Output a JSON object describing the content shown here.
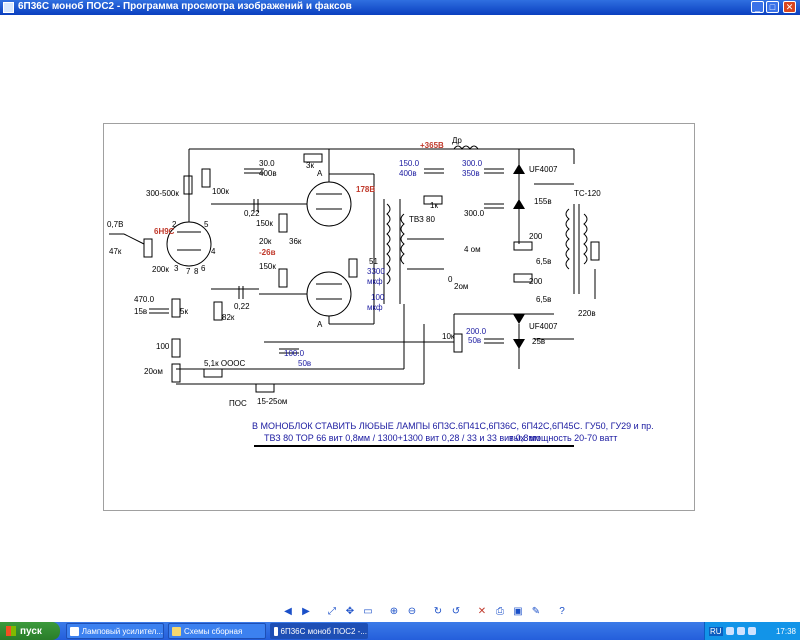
{
  "window": {
    "title": "6П36С моноб ПОС2 - Программа просмотра изображений и факсов"
  },
  "schematic": {
    "tubes": {
      "input": "6Н9С",
      "out_a": "А",
      "out_b": "А"
    },
    "transformer": {
      "output": "ТВЗ 80",
      "power": "ТС-120",
      "choke": "Др"
    },
    "components": {
      "r_300_500k": "300-500к",
      "r_100k": "100к",
      "c_30": "30.0",
      "c_30_v": "400в",
      "r_3k": "3к",
      "c_150": "150.0",
      "c_150_v": "400в",
      "c_300a": "300.0",
      "c_300a_v": "350в",
      "c_300b": "300.0",
      "r_1k": "1к",
      "v_365": "+365В",
      "v_178": "178В",
      "uf_top": "UF4007",
      "v_155": "155в",
      "c_022a": "0,22",
      "r_150k_a": "150к",
      "r_20k": "20к",
      "r_36k": "36к",
      "v_26": "-26в",
      "r_150k_b": "150к",
      "r_51": "51",
      "c_3300": "3300",
      "c_3300_u": "мкф",
      "c_100": "100",
      "c_100_u": "мкф",
      "r_200a": "200",
      "v_65a": "6,5в",
      "r_200b": "200",
      "v_65b": "6,5в",
      "v_220": "220в",
      "out_4": "4 ом",
      "out_0": "0",
      "out_2": "2ом",
      "in_v": "0,7В",
      "r_47k": "47к",
      "r_200k": "200к",
      "c_022b": "0,22",
      "c_470": "470.0",
      "c_470_v": "15в",
      "r_5k": "5к",
      "r_82k": "82к",
      "r_100": "100",
      "r_20": "20ом",
      "c_100b": "100.0",
      "c_100b_v": "50в",
      "fb_label": "5,1к ОООС",
      "pos_label": "ПОС",
      "r_1525": "15-25ом",
      "r_10k": "10к",
      "c_200": "200.0",
      "c_200_v": "50в",
      "uf_bot": "UF4007",
      "v_25": "25в",
      "pin2": "2",
      "pin3": "3",
      "pin4": "4",
      "pin5": "5",
      "pin6": "6",
      "pin7": "7",
      "pin8": "8"
    },
    "note_line1": "В  МОНОБЛОК СТАВИТЬ ЛЮБЫЕ  ЛАМПЫ 6П3С.6П41С,6П36С,  6П42С,6П45С. ГУ50, ГУ29 и пр.",
    "note_line2": "ТВЗ 80 ТОР 66 вит 0,8мм / 1300+1300 вит 0,28 / 33 и 33 вит 0,8мм.",
    "note_line2b": "вых. мощность 20-70 ватт"
  },
  "toolbar": {
    "icons": [
      "prev-icon",
      "next-icon",
      "best-fit-icon",
      "actual-size-icon",
      "slideshow-icon",
      "zoom-in-icon",
      "zoom-out-icon",
      "rotate-cw-icon",
      "rotate-ccw-icon",
      "delete-icon",
      "print-icon",
      "save-icon",
      "edit-icon",
      "help-icon"
    ]
  },
  "taskbar": {
    "start_label": "пуск",
    "tasks": [
      {
        "label": "Ламповый усилител..."
      },
      {
        "label": "Схемы сборная"
      },
      {
        "label": "6П36С моноб ПОС2 -..."
      }
    ],
    "language": "RU",
    "clock": "17:38"
  },
  "colors": {
    "titlebar": "#0a3fbf",
    "taskbar": "#245edb",
    "start": "#2a7d2a",
    "annotation_red": "#c0392b",
    "annotation_blue": "#1a1aa0"
  }
}
